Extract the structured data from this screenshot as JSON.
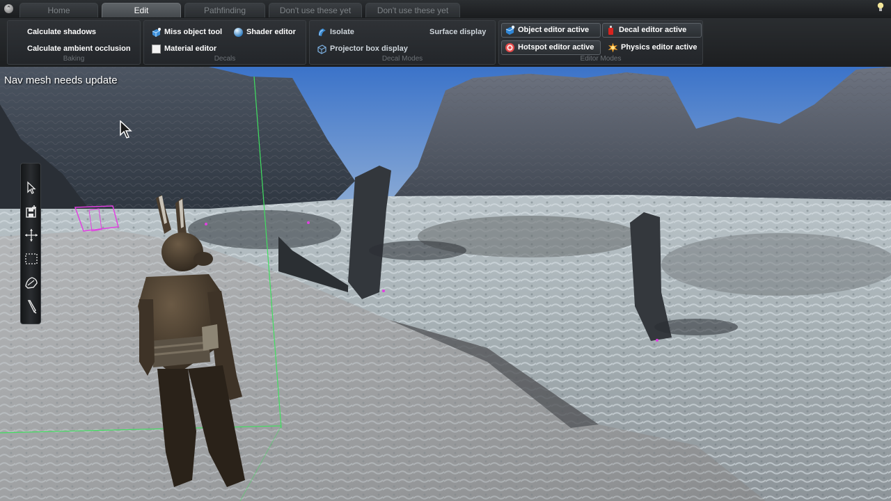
{
  "tabs": [
    {
      "label": "Home",
      "active": false
    },
    {
      "label": "Edit",
      "active": true
    },
    {
      "label": "Pathfinding",
      "active": false
    },
    {
      "label": "Don't use these yet",
      "active": false
    },
    {
      "label": "Don't use these yet",
      "active": false
    }
  ],
  "ribbon": {
    "baking": {
      "label": "Baking",
      "calculate_shadows": "Calculate shadows",
      "calculate_ambient_occlusion": "Calculate ambient occlusion"
    },
    "decals": {
      "label": "Decals",
      "miss_object_tool": "Miss object tool",
      "shader_editor": "Shader editor",
      "material_editor": "Material editor"
    },
    "decal_modes": {
      "label": "Decal Modes",
      "isolate": "Isolate",
      "surface_display": "Surface display",
      "projector_box_display": "Projector box display"
    },
    "editor_modes": {
      "label": "Editor Modes",
      "object_editor_active": "Object editor active",
      "decal_editor_active": "Decal editor active",
      "hotspot_editor_active": "Hotspot editor active",
      "physics_editor_active": "Physics editor active"
    }
  },
  "viewport": {
    "status": "Nav mesh needs update"
  },
  "toolbox": {
    "tools": [
      "select-arrow-icon",
      "save-add-icon",
      "move-gizmo-icon",
      "marquee-select-icon",
      "terrain-brush-icon",
      "paint-brush-icon"
    ]
  },
  "colors": {
    "accent_active": "#5c6268",
    "sky": "#4f7fc4",
    "gizmo_green": "#40e060",
    "nav_magenta": "#e040e0"
  }
}
